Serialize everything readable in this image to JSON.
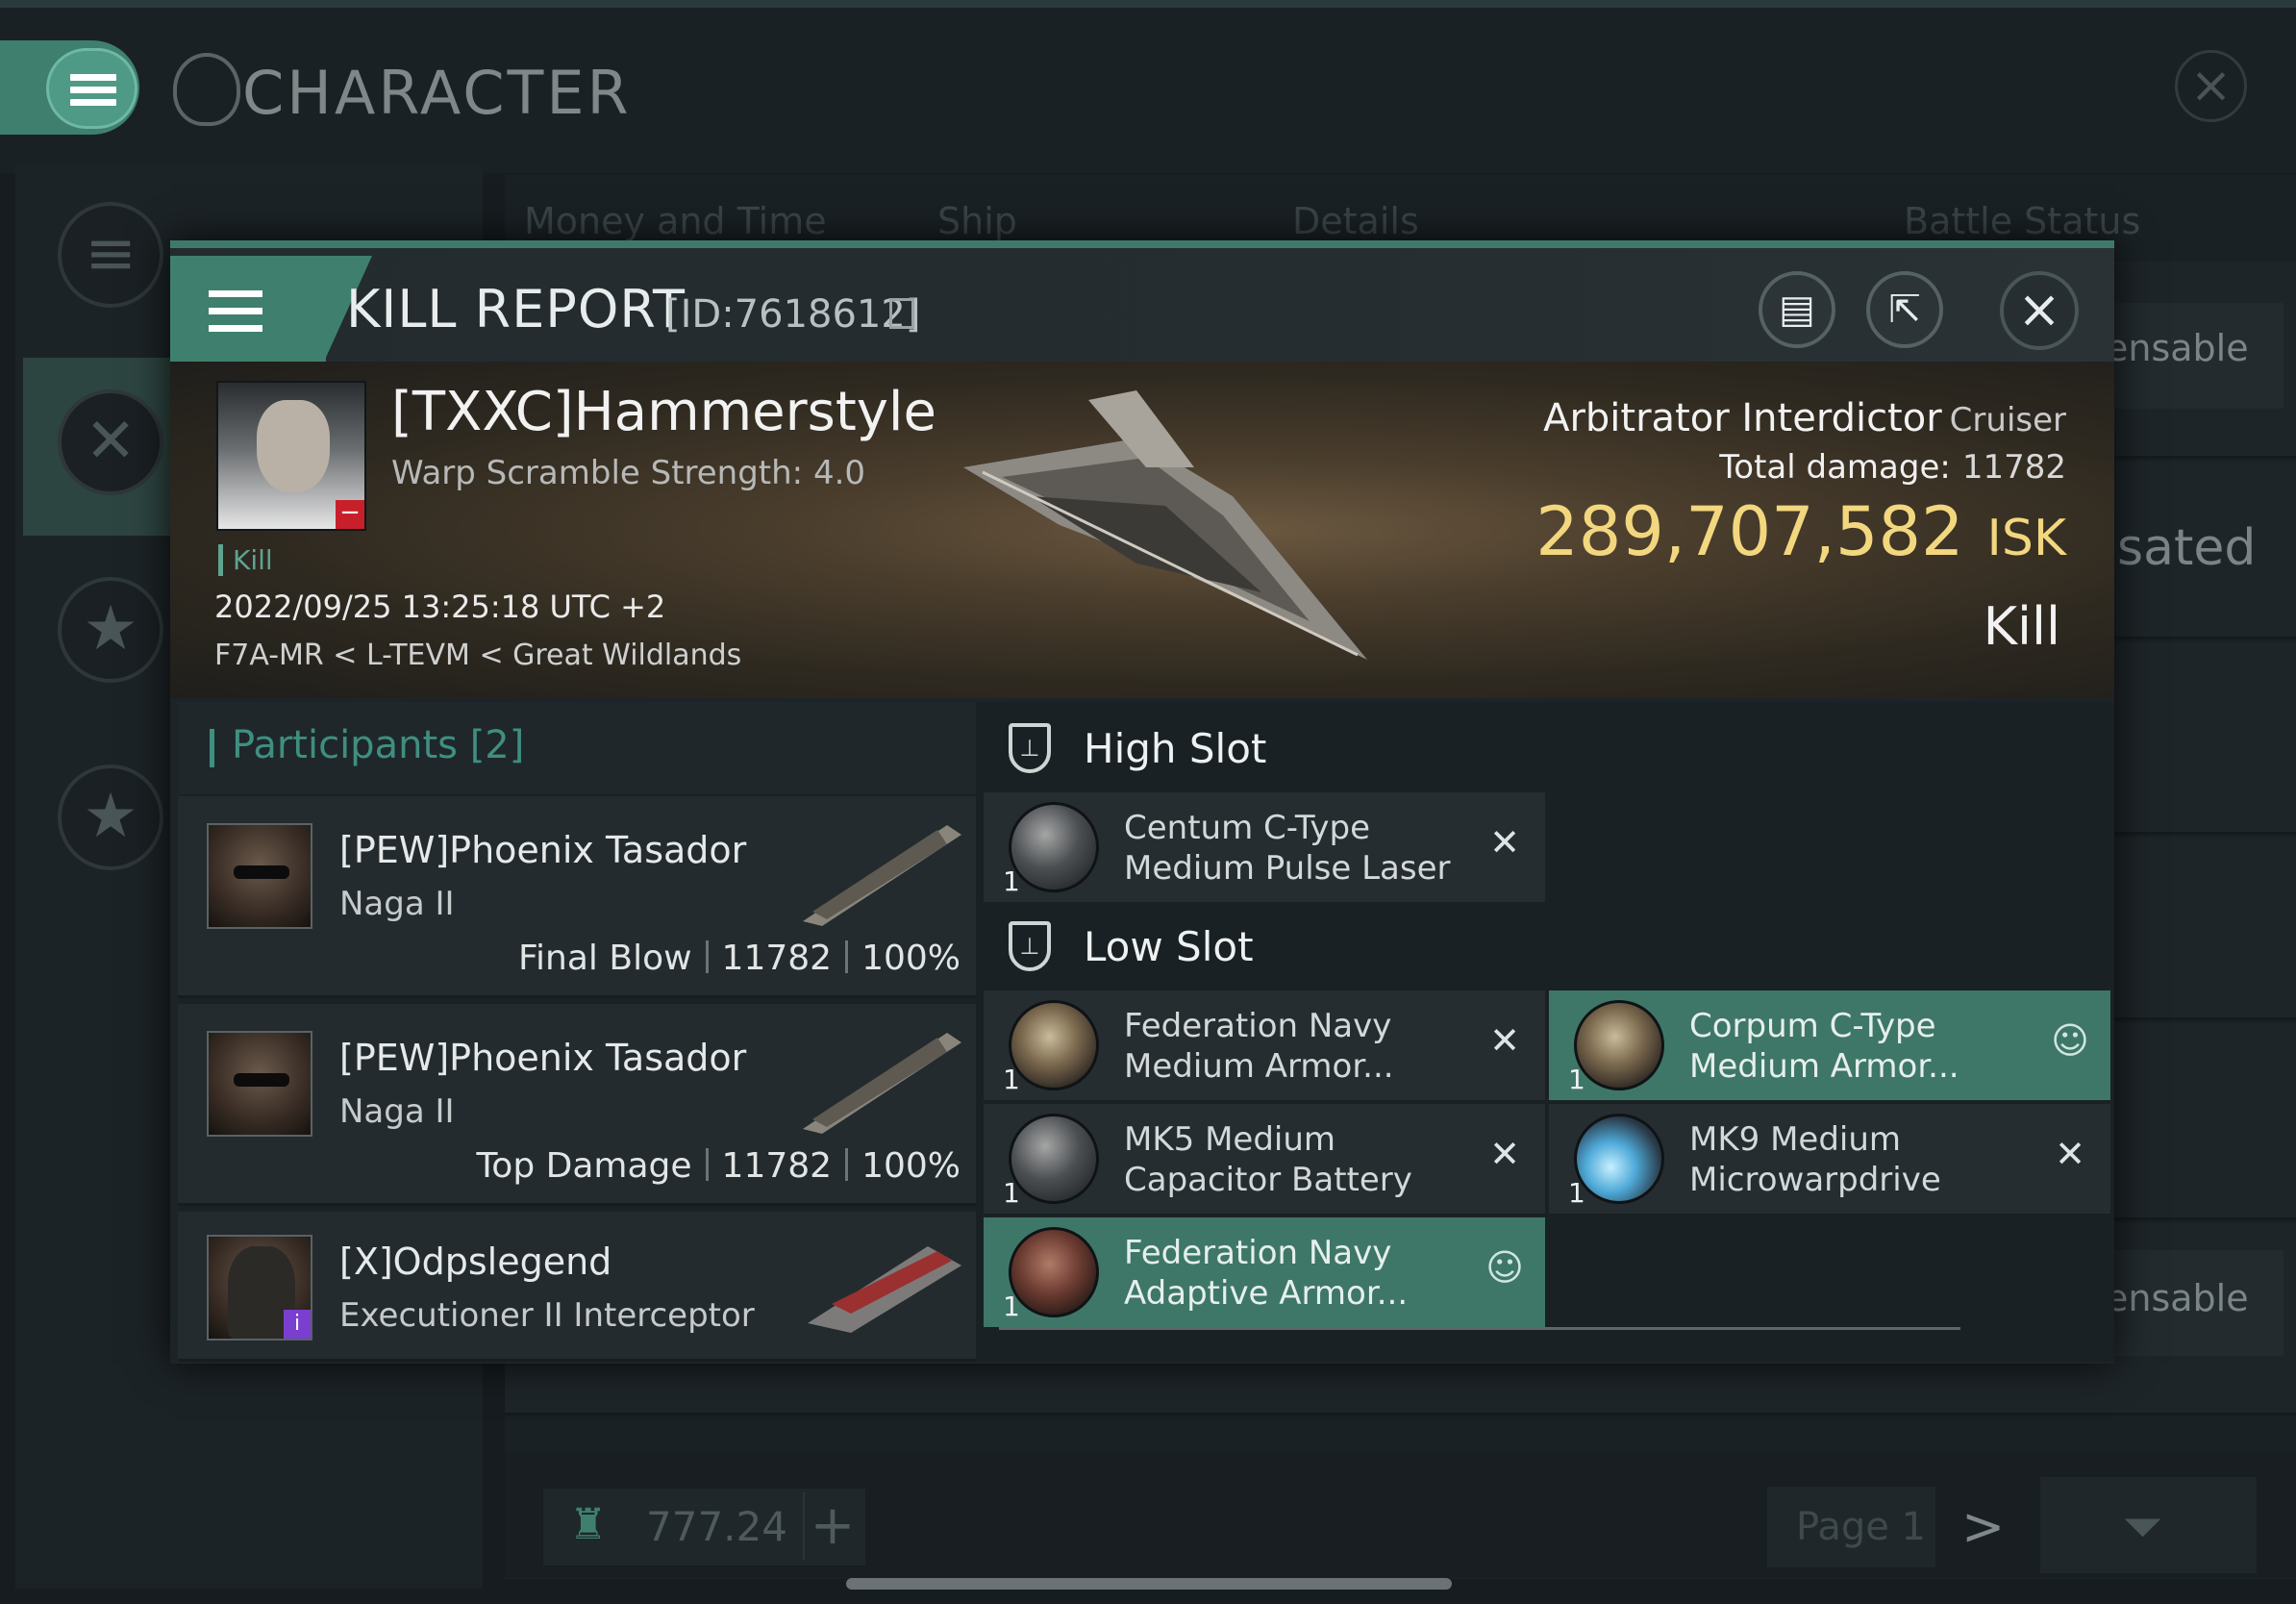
{
  "window": {
    "title": "CHARACTER"
  },
  "background_list": {
    "columns": [
      "Money and Time",
      "Ship",
      "Details",
      "Battle Status"
    ],
    "ghost_texts": [
      "ensable",
      "sated",
      "ensable"
    ]
  },
  "bottom_bar": {
    "isk_value": "777.24",
    "plus_label": "+",
    "page_label": "Page 1",
    "next_label": ">"
  },
  "kill_report": {
    "title": "KILL REPORT",
    "report_id": "[ID:7618612]",
    "victim": {
      "name": "[TXXC]Hammerstyle",
      "subtitle": "Warp Scramble Strength: 4.0",
      "tag": "Kill",
      "datetime": "2022/09/25 13:25:18 UTC +2",
      "location": "F7A-MR < L-TEVM < Great Wildlands"
    },
    "ship": {
      "name": "Arbitrator Interdictor",
      "class": "Cruiser",
      "total_damage_label": "Total damage:",
      "total_damage": "11782",
      "isk_value": "289,707,582",
      "isk_unit": "ISK",
      "result": "Kill"
    },
    "participants": {
      "label": "Participants",
      "count": "[2]",
      "rows": [
        {
          "name": "[PEW]Phoenix Tasador",
          "ship": "Naga II",
          "role": "Final Blow",
          "damage": "11782",
          "percent": "100%"
        },
        {
          "name": "[PEW]Phoenix Tasador",
          "ship": "Naga II",
          "role": "Top Damage",
          "damage": "11782",
          "percent": "100%"
        },
        {
          "name": "[X]Odpslegend",
          "ship": "Executioner II Interceptor",
          "role": "",
          "damage": "",
          "percent": ""
        }
      ]
    },
    "fitting": {
      "high_slot_label": "High Slot",
      "low_slot_label": "Low Slot",
      "high": [
        {
          "qty": "1",
          "line1": "Centum C-Type",
          "line2": "Medium Pulse Laser",
          "status": "✕"
        }
      ],
      "low": [
        {
          "qty": "1",
          "line1": "Federation Navy",
          "line2": "Medium Armor...",
          "status": "✕"
        },
        {
          "qty": "1",
          "line1": "Corpum C-Type",
          "line2": "Medium Armor...",
          "status": "person"
        },
        {
          "qty": "1",
          "line1": "MK5 Medium",
          "line2": "Capacitor Battery",
          "status": "✕"
        },
        {
          "qty": "1",
          "line1": "MK9 Medium",
          "line2": "Microwarpdrive",
          "status": "✕"
        },
        {
          "qty": "1",
          "line1": "Federation Navy",
          "line2": "Adaptive Armor...",
          "status": "person"
        }
      ]
    }
  },
  "colors": {
    "accent": "#3f7f6e",
    "isk_gold": "#f2d77f",
    "selected_module": "#3e7768"
  }
}
